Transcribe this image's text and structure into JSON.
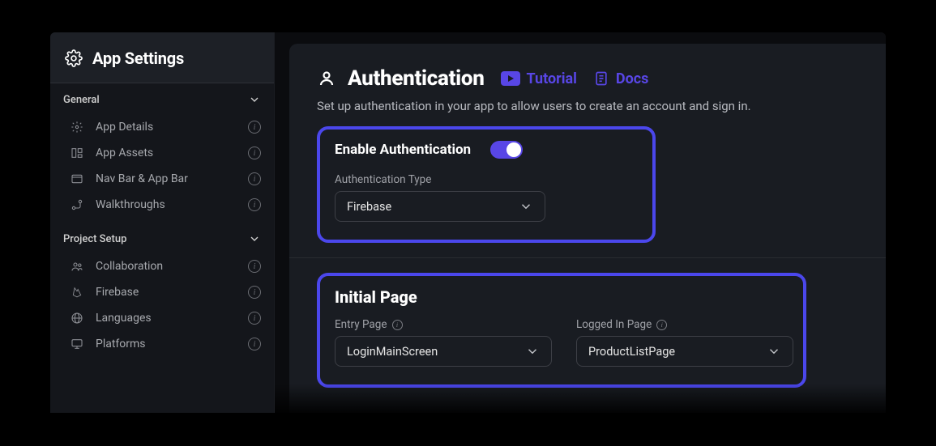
{
  "sidebar": {
    "title": "App Settings",
    "sections": [
      {
        "label": "General",
        "items": [
          {
            "label": "App Details"
          },
          {
            "label": "App Assets"
          },
          {
            "label": "Nav Bar & App Bar"
          },
          {
            "label": "Walkthroughs"
          }
        ]
      },
      {
        "label": "Project Setup",
        "items": [
          {
            "label": "Collaboration"
          },
          {
            "label": "Firebase"
          },
          {
            "label": "Languages"
          },
          {
            "label": "Platforms"
          }
        ]
      }
    ]
  },
  "page": {
    "title": "Authentication",
    "links": {
      "tutorial": "Tutorial",
      "docs": "Docs"
    },
    "subtitle": "Set up authentication in your app to allow users to create an account and sign in.",
    "enable": {
      "label": "Enable Authentication",
      "on": true
    },
    "auth_type": {
      "label": "Authentication Type",
      "value": "Firebase"
    },
    "initial_page": {
      "title": "Initial Page",
      "entry": {
        "label": "Entry Page",
        "value": "LoginMainScreen"
      },
      "logged_in": {
        "label": "Logged In Page",
        "value": "ProductListPage"
      }
    }
  }
}
